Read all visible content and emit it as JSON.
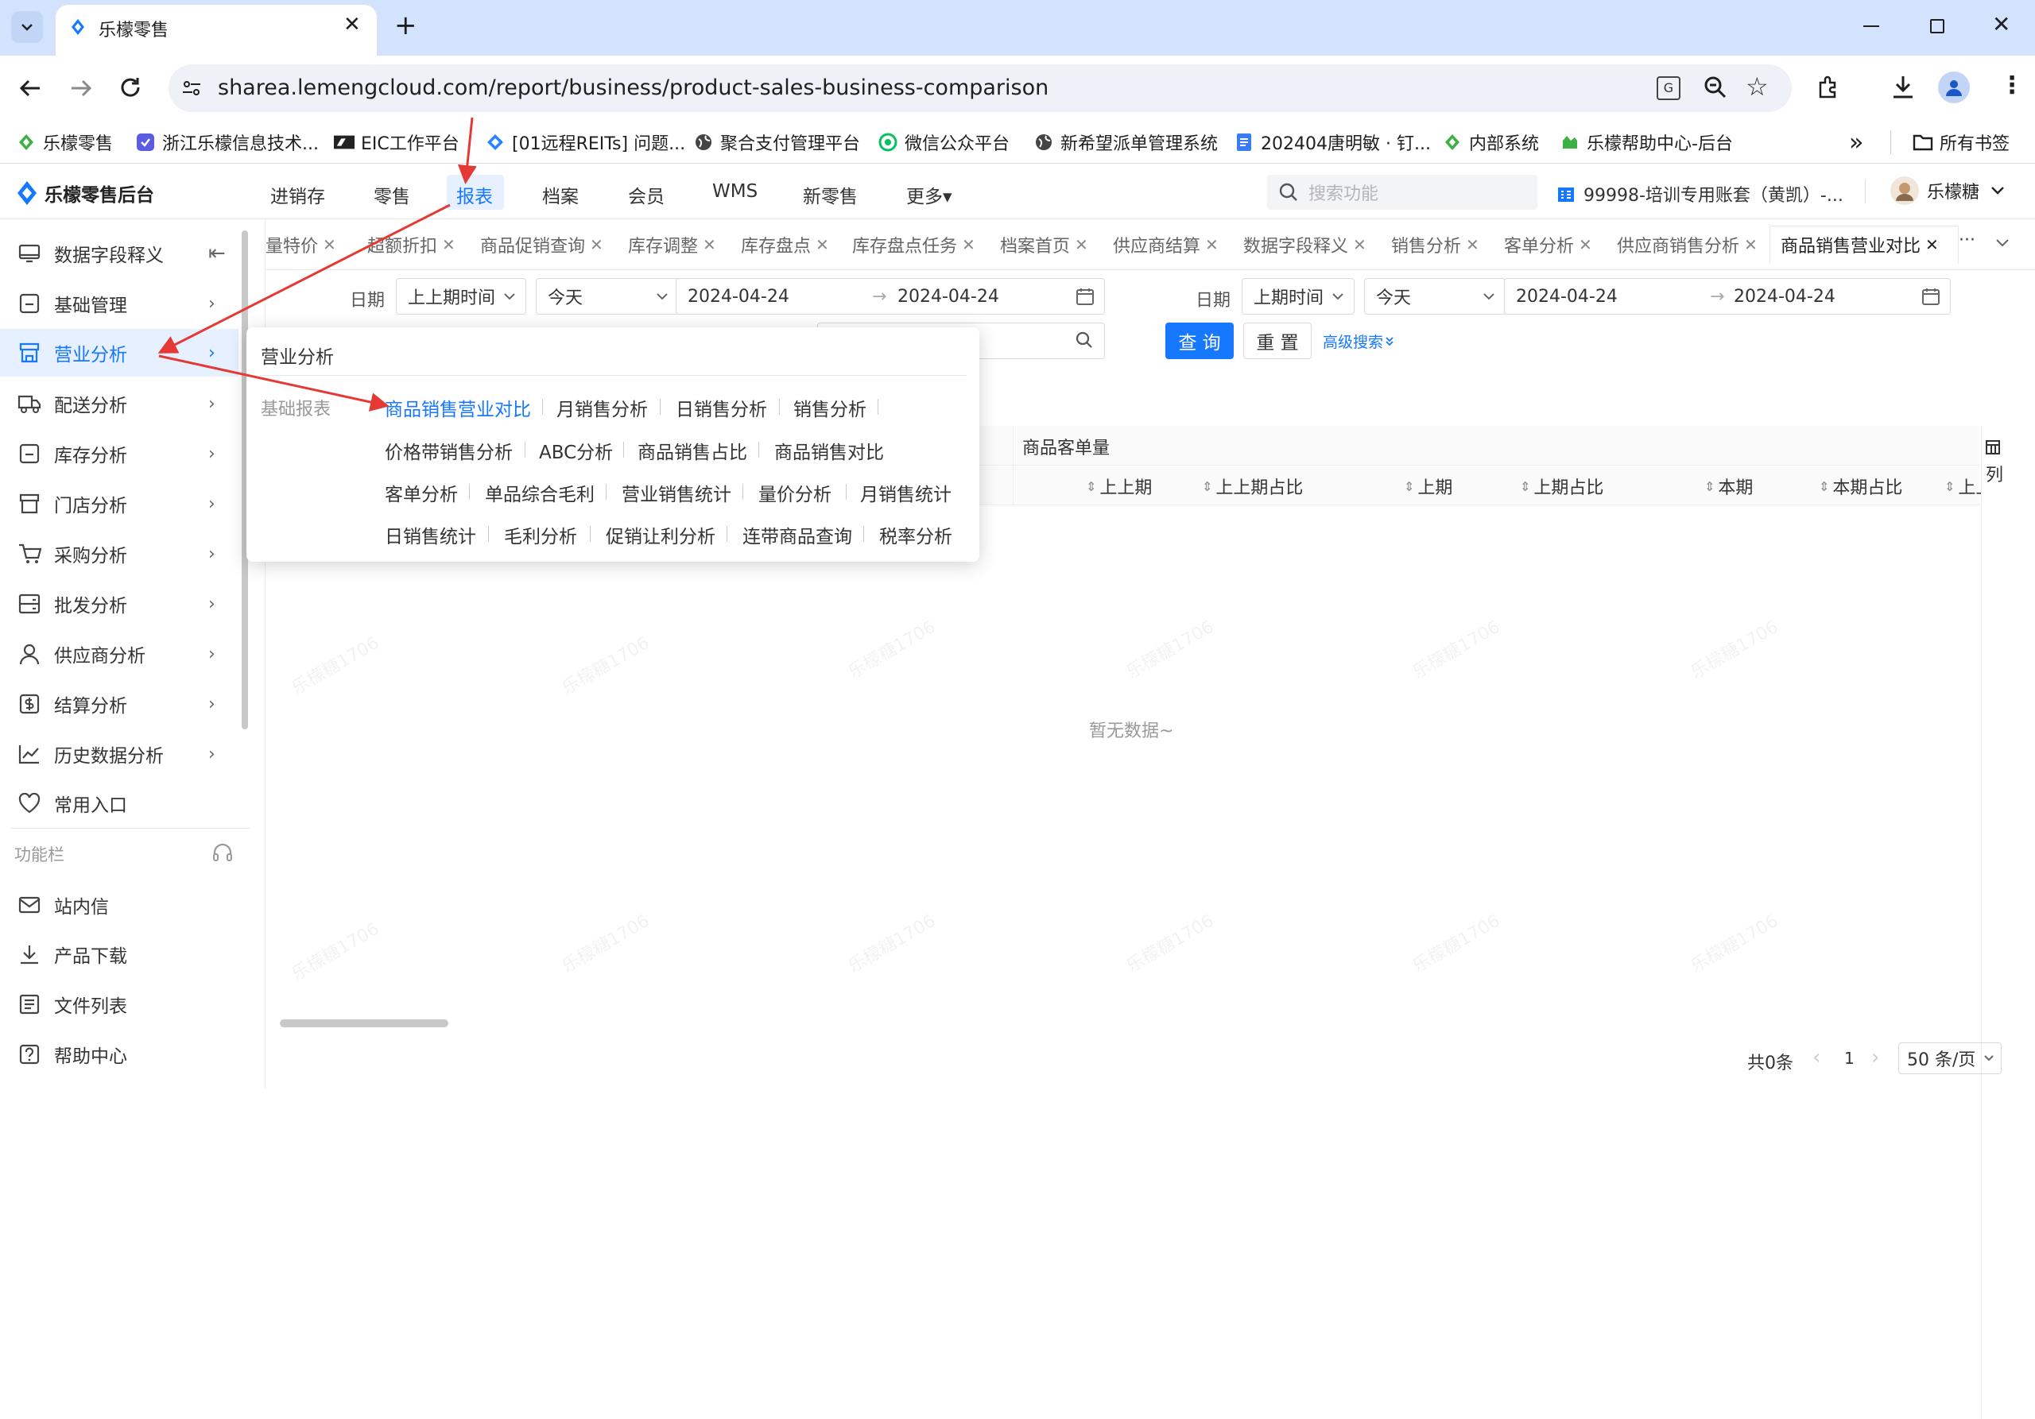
{
  "browser": {
    "tab_title": "乐檬零售",
    "url": "sharea.lemengcloud.com/report/business/product-sales-business-comparison",
    "new_tab_label": "+",
    "bookmarks": [
      "乐檬零售",
      "浙江乐檬信息技术...",
      "EIC工作平台",
      "[01远程REITs] 问题...",
      "聚合支付管理平台",
      "微信公众平台",
      "新希望派单管理系统",
      "202404唐明敏 · 钉...",
      "内部系统",
      "乐檬帮助中心-后台"
    ],
    "all_bookmarks": "所有书签",
    "overflow": "»"
  },
  "app": {
    "logo_text": "乐檬零售后台",
    "nav": [
      "进销存",
      "零售",
      "报表",
      "档案",
      "会员",
      "WMS",
      "新零售",
      "更多▾"
    ],
    "active_nav": "报表",
    "search_placeholder": "搜索功能",
    "account": "99998-培训专用账套（黄凯）-...",
    "user": "乐檬糖"
  },
  "sidebar": {
    "items": [
      {
        "label": "数据字段释义",
        "icon": "monitor-icon",
        "arrow": "⇤"
      },
      {
        "label": "基础管理",
        "icon": "minus-box-icon",
        "arrow": "›"
      },
      {
        "label": "营业分析",
        "icon": "store-icon",
        "arrow": "›"
      },
      {
        "label": "配送分析",
        "icon": "truck-icon",
        "arrow": "›"
      },
      {
        "label": "库存分析",
        "icon": "minus-box-icon",
        "arrow": "›"
      },
      {
        "label": "门店分析",
        "icon": "shop-icon",
        "arrow": "›"
      },
      {
        "label": "采购分析",
        "icon": "cart-icon",
        "arrow": "›"
      },
      {
        "label": "批发分析",
        "icon": "server-icon",
        "arrow": "›"
      },
      {
        "label": "供应商分析",
        "icon": "user-icon",
        "arrow": "›"
      },
      {
        "label": "结算分析",
        "icon": "dollar-box-icon",
        "arrow": "›"
      },
      {
        "label": "历史数据分析",
        "icon": "line-chart-icon",
        "arrow": "›"
      },
      {
        "label": "常用入口",
        "icon": "heart-icon",
        "arrow": ""
      }
    ],
    "section_label": "功能栏",
    "func_items": [
      {
        "label": "站内信",
        "icon": "mail-icon"
      },
      {
        "label": "产品下载",
        "icon": "download-icon"
      },
      {
        "label": "文件列表",
        "icon": "file-list-icon"
      },
      {
        "label": "帮助中心",
        "icon": "help-icon"
      }
    ]
  },
  "page_tabs": [
    "量特价",
    "超额折扣",
    "商品促销查询",
    "库存调整",
    "库存盘点",
    "库存盘点任务",
    "档案首页",
    "供应商结算",
    "数据字段释义",
    "销售分析",
    "客单分析",
    "供应商销售分析",
    "商品销售营业对比"
  ],
  "page_tabs_more": "···",
  "filters": {
    "left": {
      "label": "日期",
      "period": "上上期时间",
      "quick": "今天",
      "start": "2024-04-24",
      "end": "2024-04-24"
    },
    "right": {
      "label": "日期",
      "period": "上期时间",
      "quick": "今天",
      "start": "2024-04-24",
      "end": "2024-04-24"
    },
    "query_btn": "查 询",
    "reset_btn": "重 置",
    "advanced": "高级搜索"
  },
  "table": {
    "group_header": "商品客单量",
    "columns": [
      "上上期",
      "上上期占比",
      "上期",
      "上期占比",
      "本期",
      "本期占比",
      "上上"
    ],
    "column_setting": "列",
    "empty": "暂无数据~"
  },
  "pagination": {
    "total": "共0条",
    "page": "1",
    "page_size": "50 条/页"
  },
  "popover": {
    "title": "营业分析",
    "group_label": "基础报表",
    "rows": [
      [
        "商品销售营业对比",
        "月销售分析",
        "日销售分析",
        "销售分析"
      ],
      [
        "价格带销售分析",
        "ABC分析",
        "商品销售占比",
        "商品销售对比"
      ],
      [
        "客单分析",
        "单品综合毛利",
        "营业销售统计",
        "量价分析",
        "月销售统计"
      ],
      [
        "日销售统计",
        "毛利分析",
        "促销让利分析",
        "连带商品查询",
        "税率分析"
      ]
    ]
  },
  "watermark": "乐檬糖1706",
  "colors": {
    "primary": "#1677ff",
    "annotation": "#e53935"
  }
}
